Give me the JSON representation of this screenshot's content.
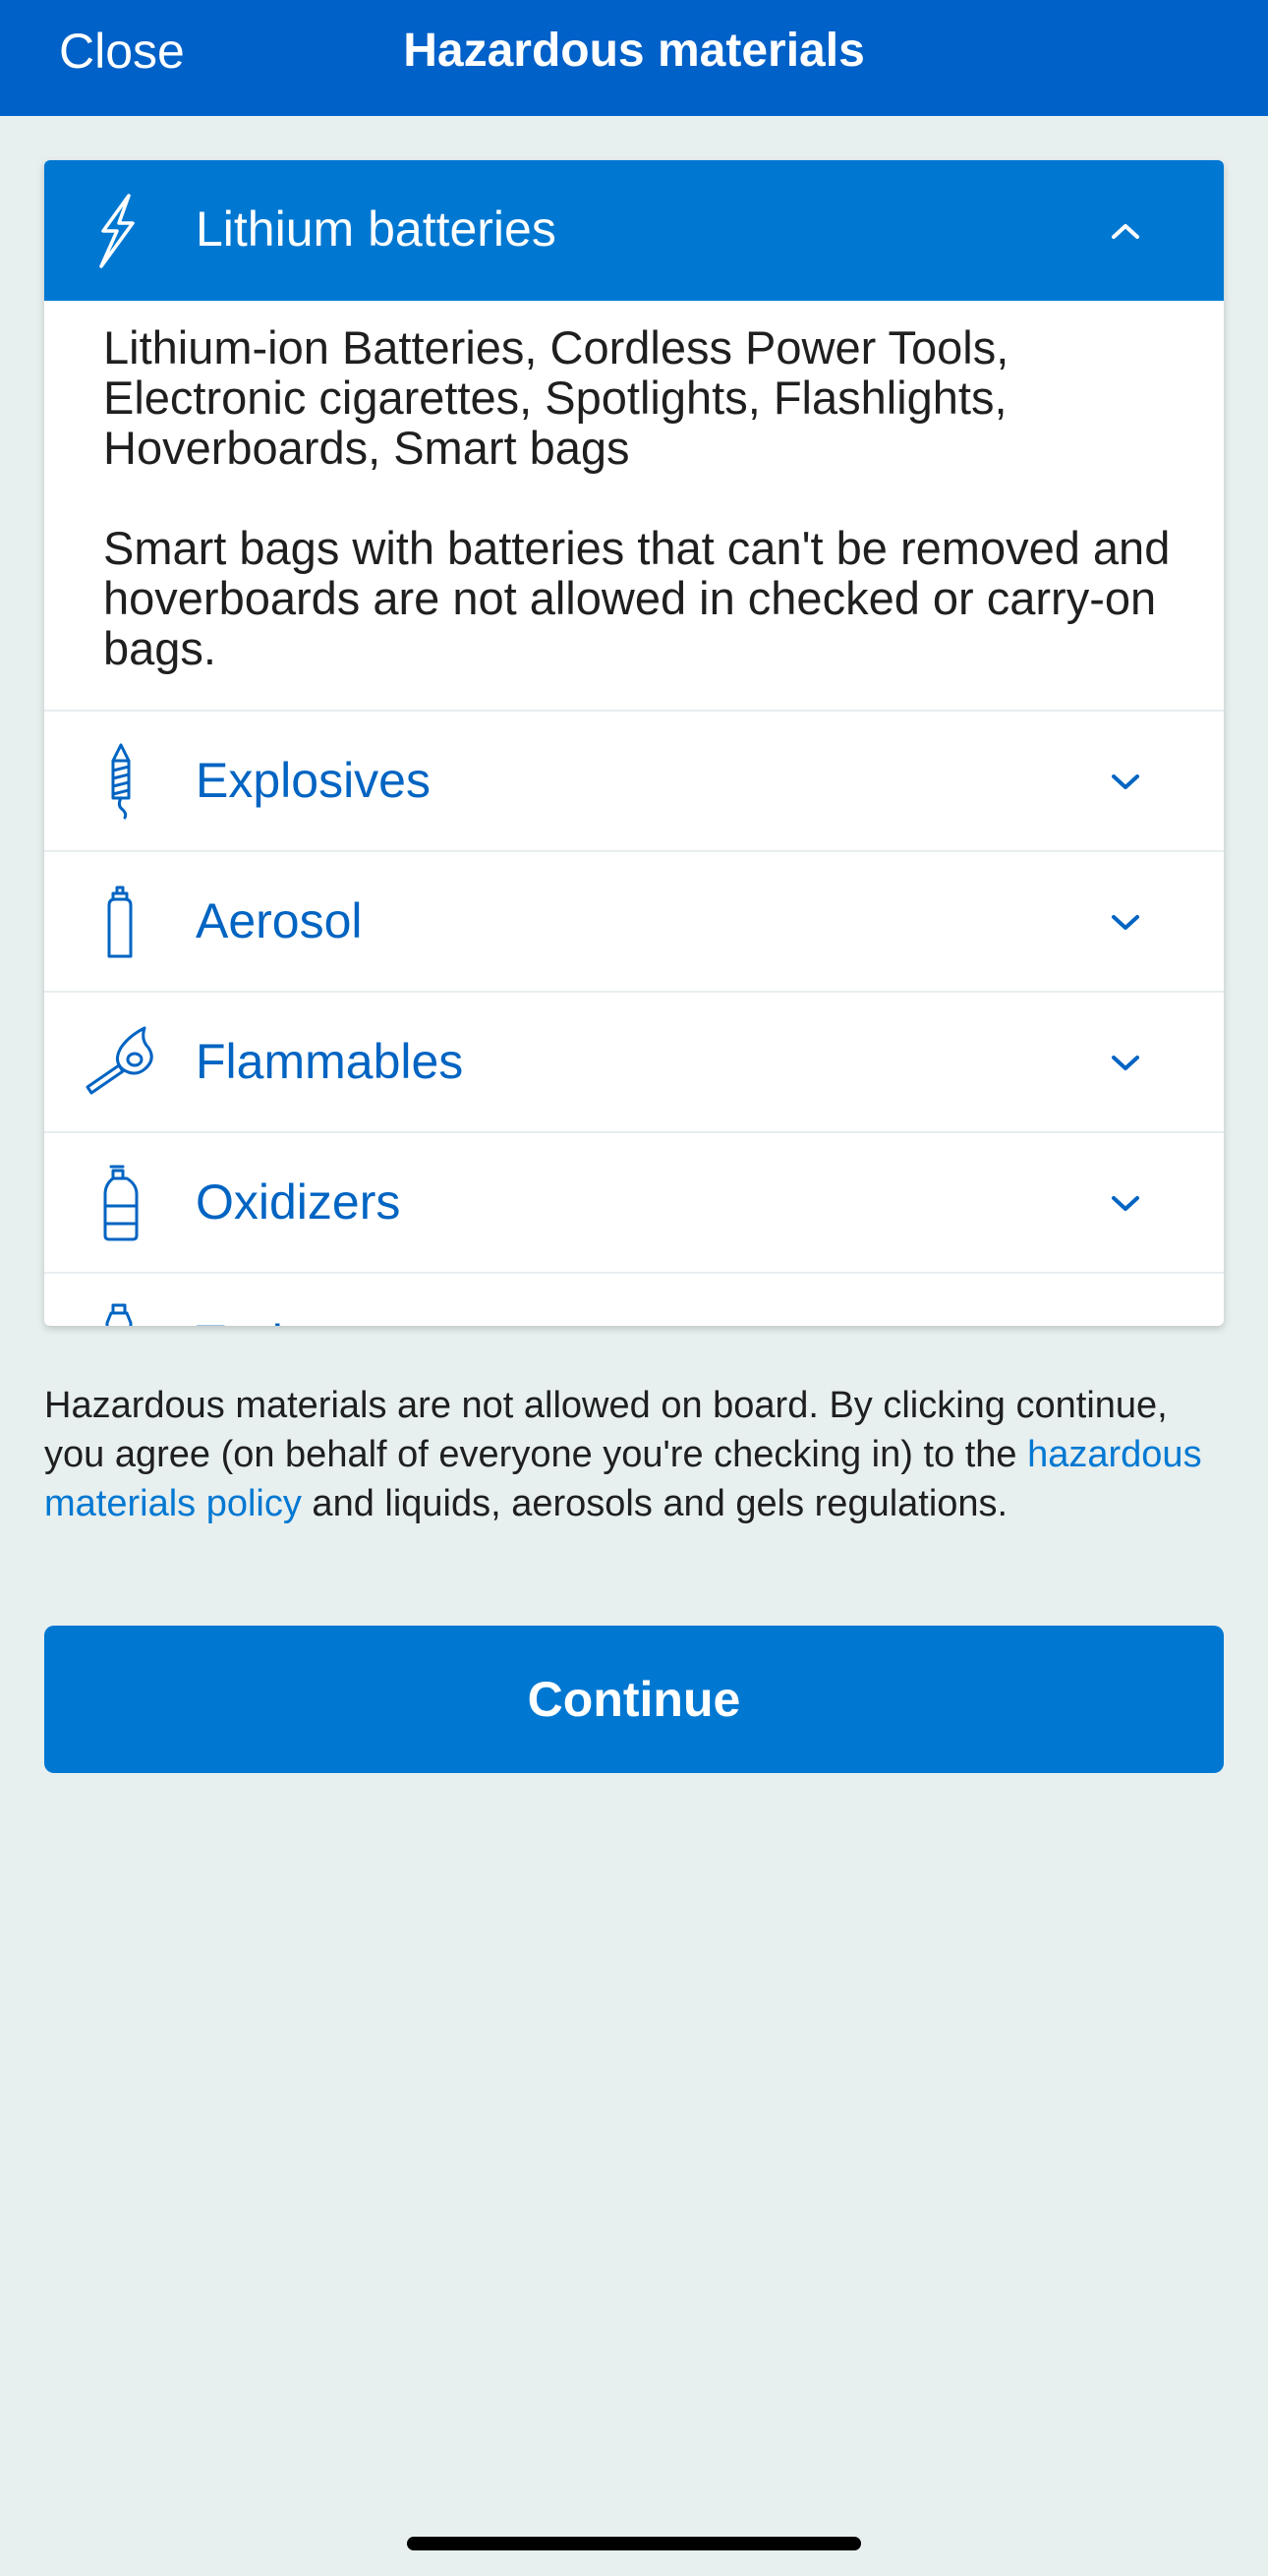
{
  "header": {
    "close_label": "Close",
    "title": "Hazardous materials"
  },
  "accordion": {
    "open_item": {
      "label": "Lithium batteries",
      "icon": "lightning-bolt-icon",
      "expanded": true,
      "body_paragraphs": [
        "Lithium-ion Batteries, Cordless Power Tools, Electronic cigarettes, Spotlights, Flashlights, Hoverboards, Smart bags",
        "Smart bags with batteries that can't be removed and hoverboards are not allowed in checked or carry-on bags."
      ]
    },
    "items": [
      {
        "label": "Explosives",
        "icon": "firework-icon"
      },
      {
        "label": "Aerosol",
        "icon": "aerosol-can-icon"
      },
      {
        "label": "Flammables",
        "icon": "match-icon"
      },
      {
        "label": "Oxidizers",
        "icon": "bleach-bottle-icon"
      },
      {
        "label": "Toxins",
        "icon": "toxin-bottle-icon"
      }
    ]
  },
  "disclaimer": {
    "text_before_link": "Hazardous materials are not allowed on board. By clicking continue, you agree (on behalf of everyone you're checking in) to the ",
    "link_text": "hazardous materials policy",
    "text_after_link": " and liquids, aerosols and gels regulations."
  },
  "continue_label": "Continue",
  "colors": {
    "header_bg": "#0061c8",
    "accent": "#0078d2",
    "link": "#0078d2",
    "item_text": "#0064c2",
    "page_bg": "#e7efef"
  }
}
